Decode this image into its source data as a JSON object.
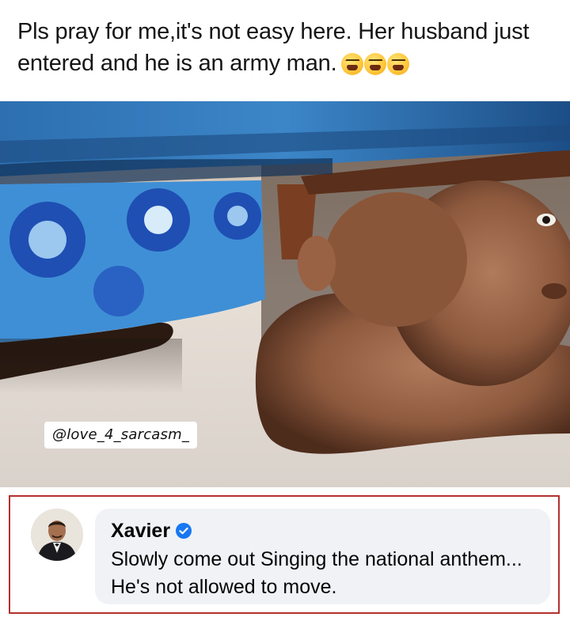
{
  "post": {
    "caption": "Pls pray for me,it's not easy here. Her husband just entered and he is an army man.",
    "caption_emojis": [
      "tired-face-emoji",
      "tired-face-emoji",
      "tired-face-emoji"
    ],
    "watermark": "@love_4_sarcasm_"
  },
  "comment": {
    "author": "Xavier",
    "verified": true,
    "text": "Slowly come out Singing the national anthem... He's not allowed to move.",
    "highlight_color": "#b3312f",
    "verified_color": "#1877f2"
  }
}
